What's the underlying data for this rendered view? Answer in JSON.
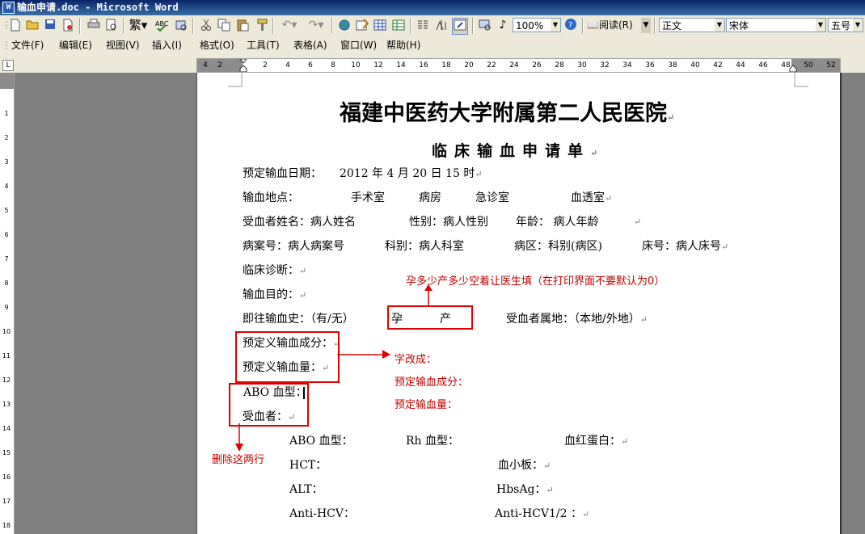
{
  "window": {
    "title": "输血申请.doc - Microsoft Word"
  },
  "toolbar": {
    "zoom": "100%",
    "read_label": "阅读(R)",
    "style": "正文",
    "font": "宋体",
    "size": "五号",
    "icons": [
      "new-icon",
      "open-icon",
      "save-icon",
      "permission-icon",
      "print-icon",
      "print-preview-icon",
      "research-icon",
      "spelling-icon",
      "cut-icon",
      "copy-icon",
      "paste-icon",
      "format-painter-icon",
      "undo-icon",
      "redo-icon",
      "hyperlink-icon",
      "tables-borders-icon",
      "insert-table-icon",
      "insert-excel-icon",
      "columns-icon",
      "drawing-icon",
      "document-map-icon",
      "show-hide-icon",
      "help-icon"
    ]
  },
  "menu": {
    "items": [
      "文件(F)",
      "编辑(E)",
      "视图(V)",
      "插入(I)",
      "格式(O)",
      "工具(T)",
      "表格(A)",
      "窗口(W)",
      "帮助(H)"
    ]
  },
  "ruler": {
    "ticks": [
      "4",
      "2",
      "2",
      "4",
      "6",
      "8",
      "10",
      "12",
      "14",
      "16",
      "18",
      "20",
      "22",
      "24",
      "26",
      "28",
      "30",
      "32",
      "34",
      "36",
      "38",
      "40",
      "42",
      "44",
      "46",
      "48",
      "50",
      "52"
    ],
    "vticks": [
      "1",
      "2",
      "3",
      "4",
      "5",
      "6",
      "7",
      "8",
      "9",
      "10",
      "11",
      "12",
      "13",
      "14",
      "15",
      "16",
      "17",
      "18"
    ]
  },
  "doc": {
    "title": "福建中医药大学附属第二人民医院",
    "subtitle": "临床输血申请单",
    "return_mark": "↵",
    "date_label": "预定输血日期：",
    "date_value": "2012 年 4 月 20 日 15 时",
    "place_label": "输血地点：",
    "place_options": [
      "手术室",
      "病房",
      "急诊室",
      "血透室"
    ],
    "name_label": "受血者姓名：病人姓名",
    "sex_label": "性别：病人性别",
    "age_label": "年龄： 病人年龄",
    "case_label": "病案号：病人病案号",
    "dept_label": "科别：病人科室",
    "ward_label": "病区：科别(病区)",
    "bed_label": "床号：病人床号",
    "diagnosis_label": "临床诊断：",
    "purpose_label": "输血目的：",
    "history_label": "即往输血史：（有/无）",
    "preg_label": "孕",
    "birth_label": "产",
    "residence_label": "受血者属地：（本地/外地）",
    "component_label": "预定义输血成分：",
    "amount_label": "预定义输血量：",
    "abo_label": "ABO 血型：",
    "recipient_label": "受血者：",
    "abo2_label": "ABO 血型：",
    "rh_label": "Rh 血型：",
    "hb_label": "血红蛋白：",
    "hct_label": "HCT：",
    "plt_label": "血小板：",
    "alt_label": "ALT：",
    "hbsag_label": "HbsAg：",
    "antihcv_label": "Anti-HCV：",
    "antihiv_label": "Anti-HCV1/2 ："
  },
  "annotations": {
    "preg_note": "孕多少产多少空着让医生填（在打印界面不要默认为0）",
    "rename_note_1": "字改成：",
    "rename_note_2": "预定输血成分：",
    "rename_note_3": "预定输血量：",
    "delete_note": "删除这两行",
    "color": "#c00000",
    "box_color": "#e00000"
  }
}
